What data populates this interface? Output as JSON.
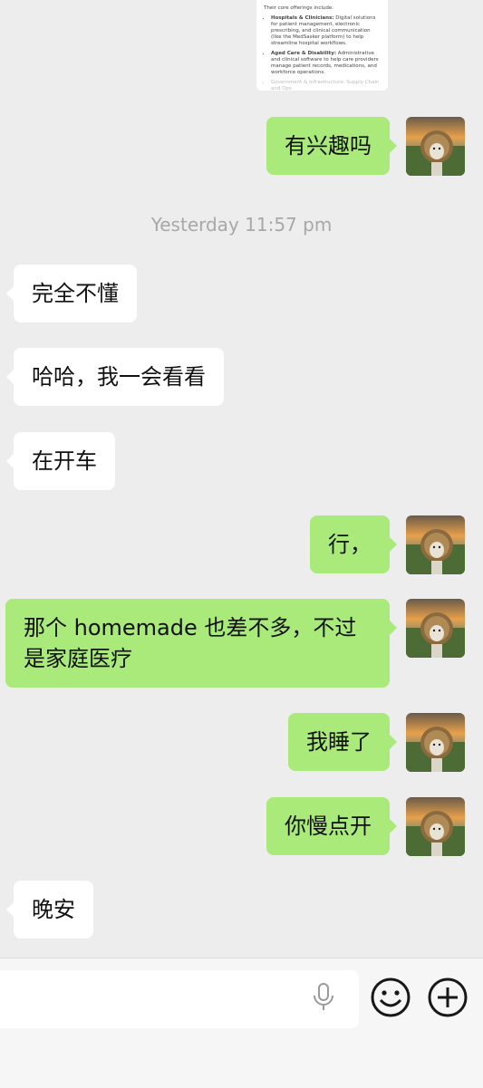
{
  "shared_card": {
    "intro": "Their core offerings include:",
    "bullets": [
      {
        "bold": "Hospitals & Clinicians:",
        "text": "Digital solutions for patient management, electronic prescribing, and clinical communication (like the MedSasker platform) to help streamline hospital workflows."
      },
      {
        "bold": "Aged Care & Disability:",
        "text": "Administrative and clinical software to help care providers manage patient records, medications, and workforce operations."
      }
    ],
    "faded_line": "Government & Infrastructure: Supply Chain and Ops"
  },
  "timestamp": "Yesterday 11:57 pm",
  "messages": [
    {
      "side": "me",
      "text": "有兴趣吗"
    },
    {
      "side": "them",
      "text": "完全不懂"
    },
    {
      "side": "them",
      "text": "哈哈，我一会看看"
    },
    {
      "side": "them",
      "text": "在开车"
    },
    {
      "side": "me",
      "text": "行，"
    },
    {
      "side": "me",
      "text": "那个 homemade 也差不多，不过是家庭医疗"
    },
    {
      "side": "me",
      "text": "我睡了"
    },
    {
      "side": "me",
      "text": "你慢点开"
    },
    {
      "side": "them",
      "text": "晚安"
    }
  ],
  "input": {
    "value": "",
    "placeholder": ""
  },
  "icons": {
    "voice": "microphone-icon",
    "emoji": "emoji-icon",
    "more": "plus-icon"
  },
  "colors": {
    "background": "#ededed",
    "my_bubble": "#a9ea7a",
    "their_bubble": "#ffffff",
    "timestamp": "#a8a8a8"
  }
}
